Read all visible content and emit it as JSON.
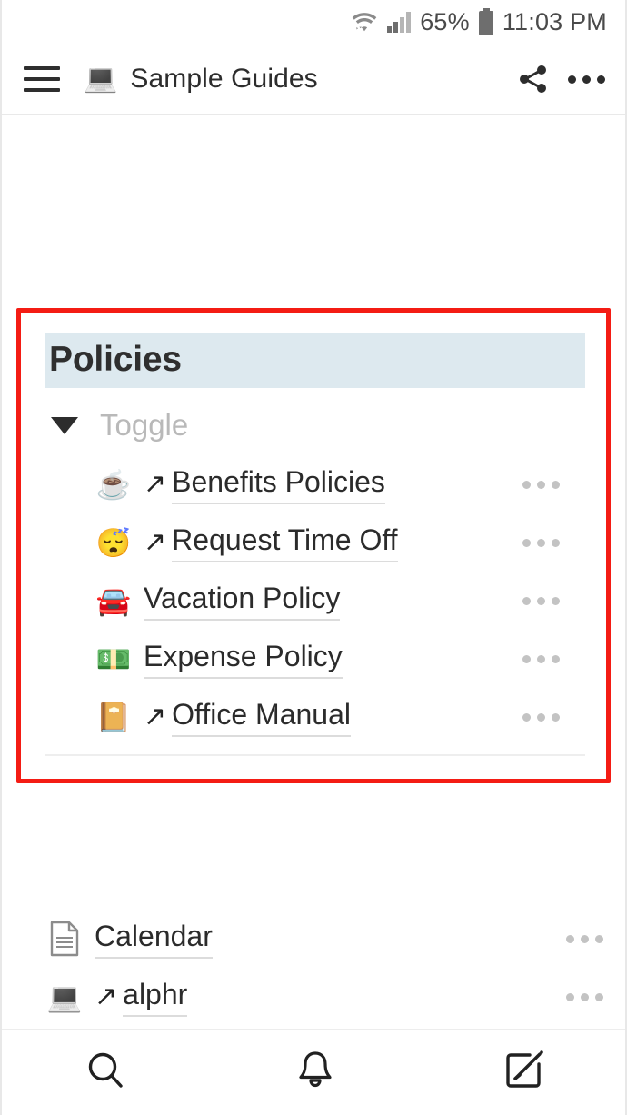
{
  "status_bar": {
    "wifi_icon": "wifi-icon",
    "signal_icon": "cellular-signal-icon",
    "battery_percent": "65%",
    "battery_icon": "battery-icon",
    "time": "11:03 PM"
  },
  "header": {
    "menu_icon": "hamburger-menu-icon",
    "page_emoji": "💻",
    "title": "Sample Guides",
    "share_icon": "share-icon",
    "more_icon": "more-options-icon"
  },
  "annotation": {
    "highlight_color": "#f41c14"
  },
  "main": {
    "section": {
      "title": "Policies",
      "title_background": "#dde9ef",
      "toggle": {
        "caret_icon": "triangle-down-icon",
        "label": "Toggle"
      },
      "rows": [
        {
          "emoji": "☕",
          "emoji_name": "coffee-emoji",
          "external": true,
          "label": "Benefits Policies",
          "menu_icon": "row-more-icon"
        },
        {
          "emoji": "😴",
          "emoji_name": "sleeping-face-emoji",
          "external": true,
          "label": "Request Time Off",
          "menu_icon": "row-more-icon"
        },
        {
          "emoji": "🚘",
          "emoji_name": "car-emoji",
          "external": false,
          "label": "Vacation Policy",
          "menu_icon": "row-more-icon"
        },
        {
          "emoji": "💵",
          "emoji_name": "banknote-emoji",
          "external": false,
          "label": "Expense Policy",
          "menu_icon": "row-more-icon"
        },
        {
          "emoji": "📔",
          "emoji_name": "notebook-emoji",
          "external": true,
          "label": "Office Manual",
          "menu_icon": "row-more-icon"
        }
      ]
    },
    "other_rows": [
      {
        "icon": "page-icon",
        "emoji": "",
        "external": false,
        "label": "Calendar",
        "menu_icon": "row-more-icon"
      },
      {
        "icon": "laptop-emoji",
        "emoji": "💻",
        "external": true,
        "label": "alphr",
        "menu_icon": "row-more-icon"
      }
    ],
    "external_link_arrow": "↗"
  },
  "bottom_bar": {
    "search_icon": "search-icon",
    "notifications_icon": "bell-icon",
    "compose_icon": "compose-icon"
  }
}
